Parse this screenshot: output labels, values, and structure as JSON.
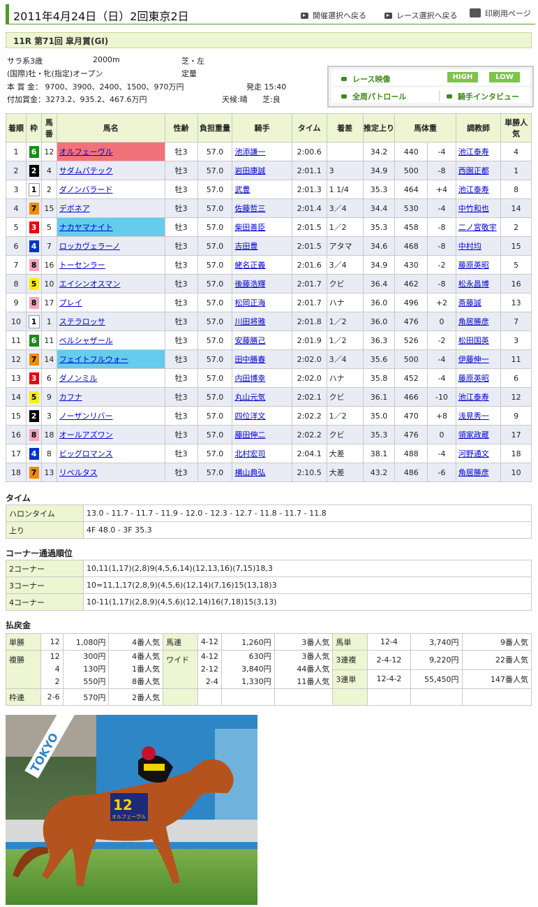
{
  "header": {
    "date": "2011年4月24日（日）2回東京2日",
    "nav_back_meeting": "開催選択へ戻る",
    "nav_back_race": "レース選択へ戻る",
    "nav_print": "印刷用ページ"
  },
  "race": {
    "title": "11R 第71回 皐月賞(GI)",
    "category": "サラ系3歳",
    "distance": "2000m",
    "surface": "芝・左",
    "conditions": "(国際)牡・牝(指定)オープン",
    "weight_rule": "定量",
    "prize": "本 賞 金： 9700、3900、2400、1500、970万円",
    "post_time": "発走 15:40",
    "add_prize": "付加賞金：3273.2、935.2、467.6万円",
    "weather": "天候:晴",
    "going": "芝:良"
  },
  "video": {
    "race_video": "レース映像",
    "high": "HIGH",
    "low": "LOW",
    "patrol": "全周パトロール",
    "interview": "騎手インタビュー"
  },
  "results": {
    "headers": [
      "着順",
      "枠",
      "馬番",
      "馬名",
      "性齢",
      "負担重量",
      "騎手",
      "タイム",
      "着差",
      "推定上り",
      "馬体重",
      "",
      "調教師",
      "単勝人気"
    ],
    "rows": [
      {
        "pos": "1",
        "waku": "6",
        "num": "12",
        "name": "オルフェーヴル",
        "sa": "牡3",
        "wt": "57.0",
        "jockey": "池添謙一",
        "time": "2:00.6",
        "margin": "",
        "last3f": "34.2",
        "bw": "440",
        "diff": "-4",
        "trainer": "池江泰寿",
        "pop": "4",
        "hl": "red"
      },
      {
        "pos": "2",
        "waku": "2",
        "num": "4",
        "name": "サダムパテック",
        "sa": "牡3",
        "wt": "57.0",
        "jockey": "岩田康誠",
        "time": "2:01.1",
        "margin": "3",
        "last3f": "34.9",
        "bw": "500",
        "diff": "-8",
        "trainer": "西園正都",
        "pop": "1",
        "hl": ""
      },
      {
        "pos": "3",
        "waku": "1",
        "num": "2",
        "name": "ダノンバラード",
        "sa": "牡3",
        "wt": "57.0",
        "jockey": "武豊",
        "time": "2:01.3",
        "margin": "1 1/4",
        "last3f": "35.3",
        "bw": "464",
        "diff": "+4",
        "trainer": "池江泰寿",
        "pop": "8",
        "hl": ""
      },
      {
        "pos": "4",
        "waku": "7",
        "num": "15",
        "name": "デボネア",
        "sa": "牡3",
        "wt": "57.0",
        "jockey": "佐藤哲三",
        "time": "2:01.4",
        "margin": "3／4",
        "last3f": "34.4",
        "bw": "530",
        "diff": "-4",
        "trainer": "中竹和也",
        "pop": "14",
        "hl": ""
      },
      {
        "pos": "5",
        "waku": "3",
        "num": "5",
        "name": "ナカヤマナイト",
        "sa": "牡3",
        "wt": "57.0",
        "jockey": "柴田善臣",
        "time": "2:01.5",
        "margin": "1／2",
        "last3f": "35.3",
        "bw": "458",
        "diff": "-8",
        "trainer": "二ノ宮敬宇",
        "pop": "2",
        "hl": "blue"
      },
      {
        "pos": "6",
        "waku": "4",
        "num": "7",
        "name": "ロッカヴェラーノ",
        "sa": "牡3",
        "wt": "57.0",
        "jockey": "吉田豊",
        "time": "2:01.5",
        "margin": "アタマ",
        "last3f": "34.6",
        "bw": "468",
        "diff": "-8",
        "trainer": "中村均",
        "pop": "15",
        "hl": ""
      },
      {
        "pos": "7",
        "waku": "8",
        "num": "16",
        "name": "トーセンラー",
        "sa": "牡3",
        "wt": "57.0",
        "jockey": "蛯名正義",
        "time": "2:01.6",
        "margin": "3／4",
        "last3f": "34.9",
        "bw": "430",
        "diff": "-2",
        "trainer": "藤原英昭",
        "pop": "5",
        "hl": ""
      },
      {
        "pos": "8",
        "waku": "5",
        "num": "10",
        "name": "エイシンオスマン",
        "sa": "牡3",
        "wt": "57.0",
        "jockey": "後藤浩輝",
        "time": "2:01.7",
        "margin": "クビ",
        "last3f": "36.4",
        "bw": "462",
        "diff": "-8",
        "trainer": "松永昌博",
        "pop": "16",
        "hl": ""
      },
      {
        "pos": "9",
        "waku": "8",
        "num": "17",
        "name": "プレイ",
        "sa": "牡3",
        "wt": "57.0",
        "jockey": "松岡正海",
        "time": "2:01.7",
        "margin": "ハナ",
        "last3f": "36.0",
        "bw": "496",
        "diff": "+2",
        "trainer": "斎藤誠",
        "pop": "13",
        "hl": ""
      },
      {
        "pos": "10",
        "waku": "1",
        "num": "1",
        "name": "ステラロッサ",
        "sa": "牡3",
        "wt": "57.0",
        "jockey": "川田将雅",
        "time": "2:01.8",
        "margin": "1／2",
        "last3f": "36.0",
        "bw": "476",
        "diff": "0",
        "trainer": "角居勝彦",
        "pop": "7",
        "hl": ""
      },
      {
        "pos": "11",
        "waku": "6",
        "num": "11",
        "name": "ベルシャザール",
        "sa": "牡3",
        "wt": "57.0",
        "jockey": "安藤勝己",
        "time": "2:01.9",
        "margin": "1／2",
        "last3f": "36.3",
        "bw": "526",
        "diff": "-2",
        "trainer": "松田国英",
        "pop": "3",
        "hl": ""
      },
      {
        "pos": "12",
        "waku": "7",
        "num": "14",
        "name": "フェイトフルウォー",
        "sa": "牡3",
        "wt": "57.0",
        "jockey": "田中勝春",
        "time": "2:02.0",
        "margin": "3／4",
        "last3f": "35.6",
        "bw": "500",
        "diff": "-4",
        "trainer": "伊藤伸一",
        "pop": "11",
        "hl": "blue"
      },
      {
        "pos": "13",
        "waku": "3",
        "num": "6",
        "name": "ダノンミル",
        "sa": "牡3",
        "wt": "57.0",
        "jockey": "内田博幸",
        "time": "2:02.0",
        "margin": "ハナ",
        "last3f": "35.8",
        "bw": "452",
        "diff": "-4",
        "trainer": "藤原英昭",
        "pop": "6",
        "hl": ""
      },
      {
        "pos": "14",
        "waku": "5",
        "num": "9",
        "name": "カフナ",
        "sa": "牡3",
        "wt": "57.0",
        "jockey": "丸山元気",
        "time": "2:02.1",
        "margin": "クビ",
        "last3f": "36.1",
        "bw": "466",
        "diff": "-10",
        "trainer": "池江泰寿",
        "pop": "12",
        "hl": ""
      },
      {
        "pos": "15",
        "waku": "2",
        "num": "3",
        "name": "ノーザンリバー",
        "sa": "牡3",
        "wt": "57.0",
        "jockey": "四位洋文",
        "time": "2:02.2",
        "margin": "1／2",
        "last3f": "35.0",
        "bw": "470",
        "diff": "+8",
        "trainer": "浅見秀一",
        "pop": "9",
        "hl": ""
      },
      {
        "pos": "16",
        "waku": "8",
        "num": "18",
        "name": "オールアズワン",
        "sa": "牡3",
        "wt": "57.0",
        "jockey": "藤田伸二",
        "time": "2:02.2",
        "margin": "クビ",
        "last3f": "35.3",
        "bw": "476",
        "diff": "0",
        "trainer": "領家政蔵",
        "pop": "17",
        "hl": ""
      },
      {
        "pos": "17",
        "waku": "4",
        "num": "8",
        "name": "ビッグロマンス",
        "sa": "牡3",
        "wt": "57.0",
        "jockey": "北村宏司",
        "time": "2:04.1",
        "margin": "大差",
        "last3f": "38.1",
        "bw": "488",
        "diff": "-4",
        "trainer": "河野通文",
        "pop": "18",
        "hl": ""
      },
      {
        "pos": "18",
        "waku": "7",
        "num": "13",
        "name": "リベルタス",
        "sa": "牡3",
        "wt": "57.0",
        "jockey": "横山典弘",
        "time": "2:10.5",
        "margin": "大差",
        "last3f": "43.2",
        "bw": "486",
        "diff": "-6",
        "trainer": "角居勝彦",
        "pop": "10",
        "hl": ""
      }
    ]
  },
  "waku_colors": {
    "1": {
      "bg": "#ffffff",
      "fg": "#000000"
    },
    "2": {
      "bg": "#000000",
      "fg": "#ffffff"
    },
    "3": {
      "bg": "#e60012",
      "fg": "#ffffff"
    },
    "4": {
      "bg": "#0033cc",
      "fg": "#ffffff"
    },
    "5": {
      "bg": "#ffee00",
      "fg": "#000000"
    },
    "6": {
      "bg": "#1c8a1c",
      "fg": "#ffffff"
    },
    "7": {
      "bg": "#f08c00",
      "fg": "#000000"
    },
    "8": {
      "bg": "#f7a4bf",
      "fg": "#000000"
    }
  },
  "time_section": {
    "title": "タイム",
    "rows": [
      {
        "label": "ハロンタイム",
        "value": "13.0 - 11.7 - 11.7 - 11.9 - 12.0 - 12.3 - 12.7 - 11.8 - 11.7 - 11.8"
      },
      {
        "label": "上り",
        "value": "4F 48.0 - 3F 35.3"
      }
    ]
  },
  "corner_section": {
    "title": "コーナー通過順位",
    "rows": [
      {
        "label": "2コーナー",
        "value": "10,11(1,17)(2,8)9(4,5,6,14)(12,13,16)(7,15)18,3"
      },
      {
        "label": "3コーナー",
        "value": "10=11,1,17(2,8,9)(4,5,6)(12,14)(7,16)15(13,18)3"
      },
      {
        "label": "4コーナー",
        "value": "10-11(1,17)(2,8,9)(4,5,6)(12,14)16(7,18)15(3,13)"
      }
    ]
  },
  "payout": {
    "title": "払戻金",
    "tansho": {
      "label": "単勝",
      "num": "12",
      "amount": "1,080円",
      "pop": "4番人気"
    },
    "umaren": {
      "label": "馬連",
      "num": "4-12",
      "amount": "1,260円",
      "pop": "3番人気"
    },
    "umatan": {
      "label": "馬単",
      "num": "12-4",
      "amount": "3,740円",
      "pop": "9番人気"
    },
    "fukusho": {
      "label": "複勝",
      "nums": "12\n4\n2",
      "amounts": "300円\n130円\n550円",
      "pops": "4番人気\n1番人気\n8番人気"
    },
    "wide": {
      "label": "ワイド",
      "nums": "4-12\n2-12\n2-4",
      "amounts": "630円\n3,840円\n1,330円",
      "pops": "3番人気\n44番人気\n11番人気"
    },
    "sanrenpuku": {
      "label": "3連複",
      "num": "2-4-12",
      "amount": "9,220円",
      "pop": "22番人気"
    },
    "sanrentan": {
      "label": "3連単",
      "num": "12-4-2",
      "amount": "55,450円",
      "pop": "147番人気"
    },
    "wakuren": {
      "label": "枠連",
      "num": "2-6",
      "amount": "570円",
      "pop": "2番人気"
    }
  },
  "photo": {
    "saddle_number": "12",
    "saddle_name": "オルフェーヴル",
    "banner_text": "TOKYO"
  }
}
